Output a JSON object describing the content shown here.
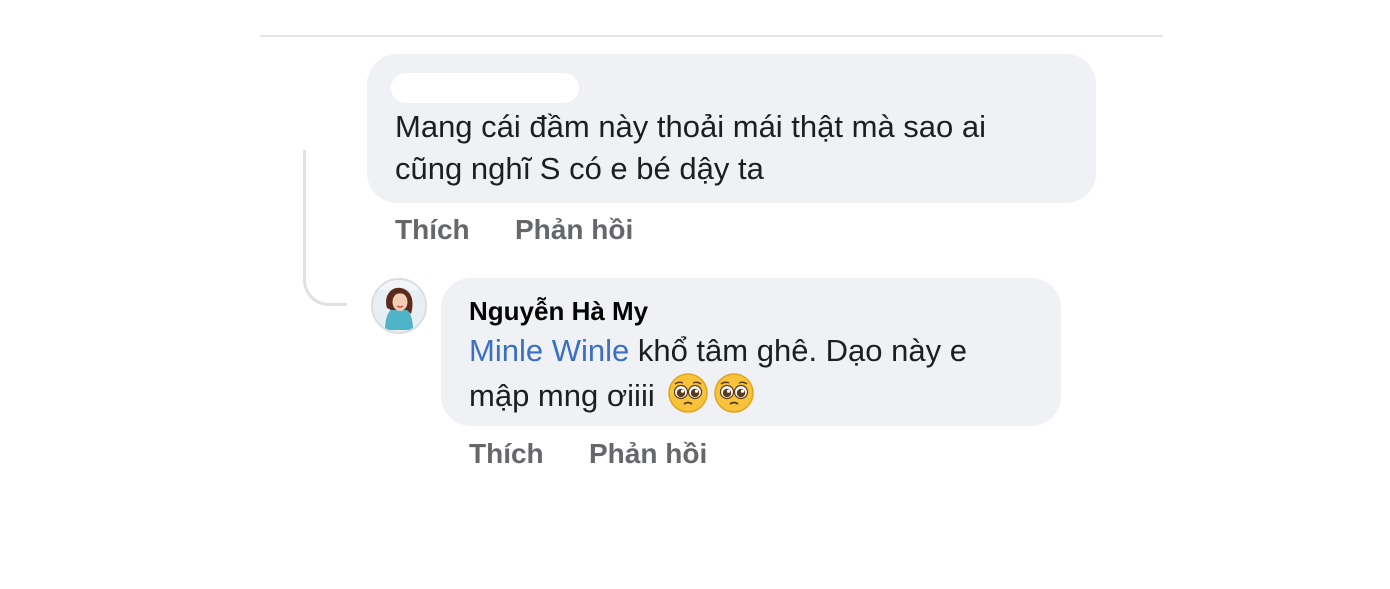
{
  "comments": [
    {
      "author": "",
      "text_line1": "Mang cái đầm này thoải mái thật mà sao ai",
      "text_line2": "cũng nghĩ S có e bé dậy ta",
      "actions": {
        "like": "Thích",
        "reply": "Phản hồi"
      }
    }
  ],
  "reply": {
    "author": "Nguyễn Hà My",
    "mention": "Minle Winle",
    "text_line1_rest": " khổ tâm ghê. Dạo này e",
    "text_line2": "mập mng ơiiii",
    "emojis": [
      "pleading-face-emoji",
      "pleading-face-emoji"
    ],
    "actions": {
      "like": "Thích",
      "reply": "Phản hồi"
    }
  },
  "colors": {
    "bubble": "#eff1f4",
    "action_text": "#65676b",
    "mention": "#3a6fc4",
    "divider": "#e4e6ea"
  }
}
